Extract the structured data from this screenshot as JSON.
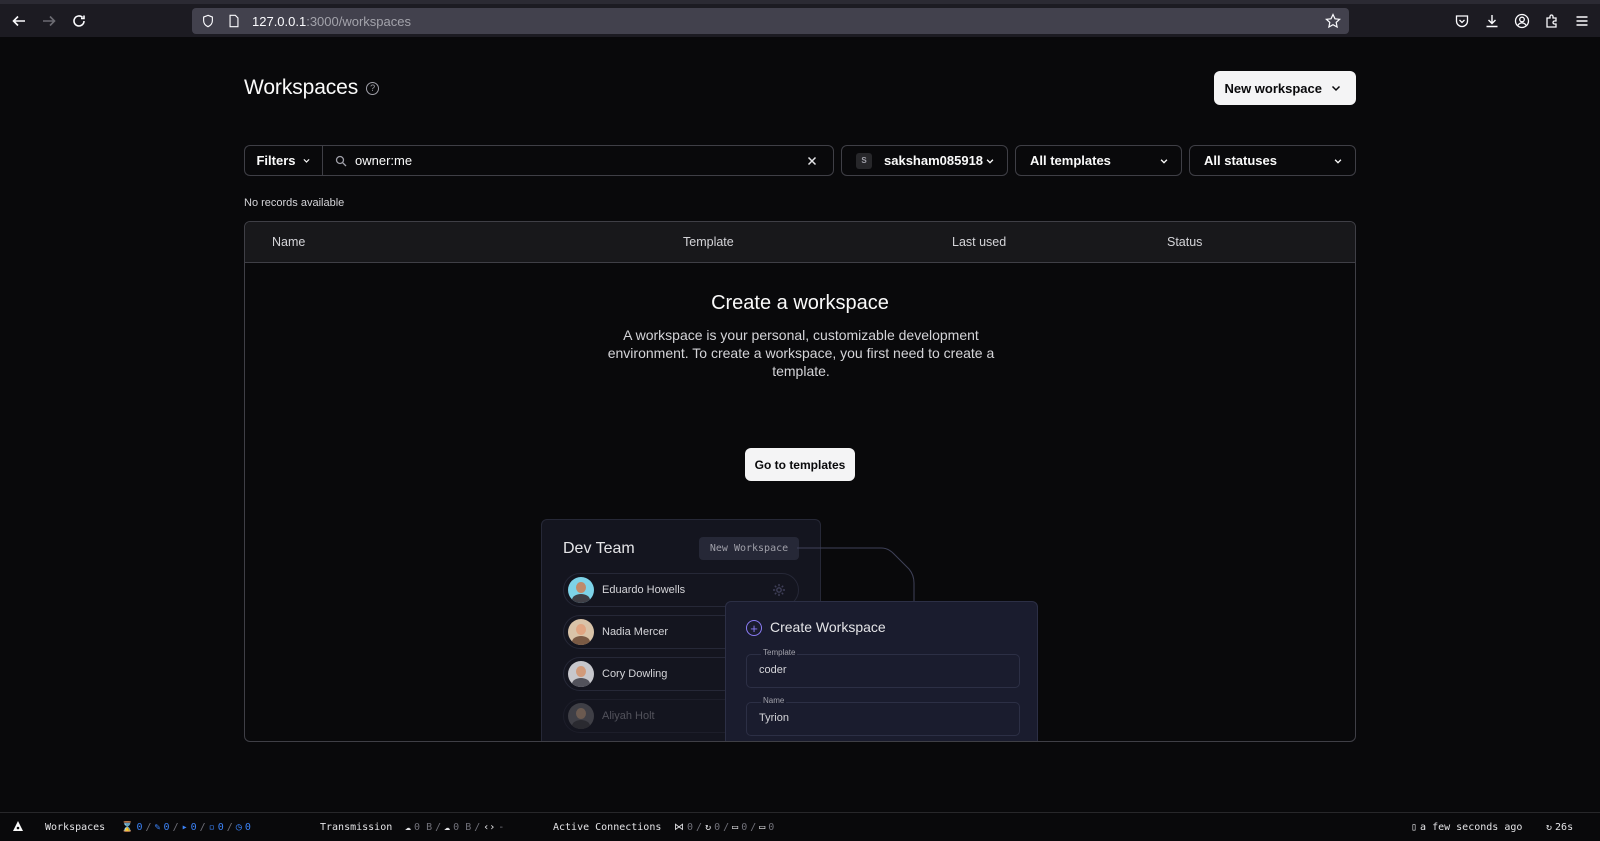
{
  "browser": {
    "url_host": "127.0.0.1",
    "url_path": ":3000/workspaces"
  },
  "header": {
    "title": "Workspaces",
    "new_workspace_label": "New workspace"
  },
  "filters": {
    "filters_label": "Filters",
    "search_value": "owner:me",
    "user_initial": "S",
    "user_label": "saksham085918",
    "templates_label": "All templates",
    "statuses_label": "All statuses"
  },
  "no_records": "No records available",
  "table": {
    "columns": [
      "Name",
      "Template",
      "Last used",
      "Status"
    ]
  },
  "empty_state": {
    "title": "Create a workspace",
    "description": "A workspace is your personal, customizable development environment. To create a workspace, you first need to create a template.",
    "button_label": "Go to templates"
  },
  "illustration": {
    "team_title": "Dev Team",
    "new_workspace_chip": "New Workspace",
    "members": [
      "Eduardo Howells",
      "Nadia Mercer",
      "Cory Dowling",
      "Aliyah Holt"
    ],
    "create_title": "Create Workspace",
    "template_label": "Template",
    "template_value": "coder",
    "name_label": "Name",
    "name_value": "Tyrion"
  },
  "statusbar": {
    "workspaces_label": "Workspaces",
    "counts": [
      "0",
      "0",
      "0",
      "0",
      "0"
    ],
    "transmission_label": "Transmission",
    "upload": "0 B",
    "download": "0 B",
    "latency": "-",
    "active_connections_label": "Active Connections",
    "conn_counts": [
      "0",
      "0",
      "0",
      "0"
    ],
    "updated": "a few seconds ago",
    "refresh": "26s"
  },
  "colors": {
    "background": "#09090b",
    "accent": "#8b7cf6",
    "status_blue": "#3b82f6"
  }
}
